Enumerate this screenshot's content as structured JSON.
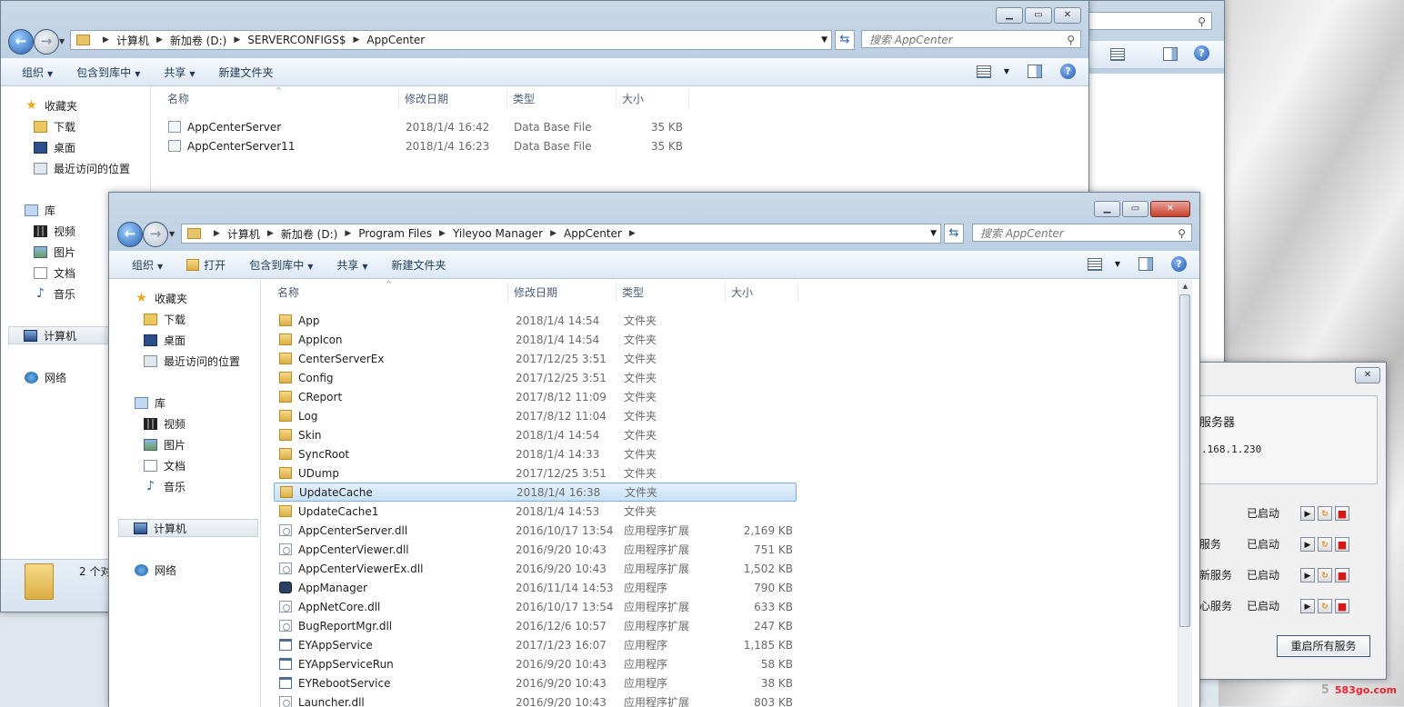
{
  "back_window": {
    "address": [
      "计算机",
      "新加卷 (D:)",
      "SERVERCONFIGS$",
      "AppCenter"
    ],
    "search_placeholder": "搜索 AppCenter",
    "commands": [
      "组织",
      "包含到库中",
      "共享",
      "新建文件夹"
    ],
    "columns": [
      "名称",
      "修改日期",
      "类型",
      "大小"
    ],
    "files": [
      {
        "name": "AppCenterServer",
        "date": "2018/1/4 16:42",
        "type": "Data Base File",
        "size": "35 KB",
        "icon": "db"
      },
      {
        "name": "AppCenterServer11",
        "date": "2018/1/4 16:23",
        "type": "Data Base File",
        "size": "35 KB",
        "icon": "db"
      }
    ],
    "nav": {
      "favorites": "收藏夹",
      "downloads": "下载",
      "desktop": "桌面",
      "recent": "最近访问的位置",
      "libraries": "库",
      "videos": "视频",
      "pictures": "图片",
      "documents": "文档",
      "music": "音乐",
      "computer": "计算机",
      "network": "网络"
    },
    "status_text": "2 个对"
  },
  "front_window": {
    "address": [
      "计算机",
      "新加卷 (D:)",
      "Program Files",
      "Yileyoo Manager",
      "AppCenter"
    ],
    "search_placeholder": "搜索 AppCenter",
    "commands": [
      "组织",
      "打开",
      "包含到库中",
      "共享",
      "新建文件夹"
    ],
    "columns": [
      "名称",
      "修改日期",
      "类型",
      "大小"
    ],
    "nav": {
      "favorites": "收藏夹",
      "downloads": "下载",
      "desktop": "桌面",
      "recent": "最近访问的位置",
      "libraries": "库",
      "videos": "视频",
      "pictures": "图片",
      "documents": "文档",
      "music": "音乐",
      "computer": "计算机",
      "network": "网络"
    },
    "files": [
      {
        "name": "App",
        "date": "2018/1/4 14:54",
        "type": "文件夹",
        "size": "",
        "icon": "folder"
      },
      {
        "name": "AppIcon",
        "date": "2018/1/4 14:54",
        "type": "文件夹",
        "size": "",
        "icon": "folder"
      },
      {
        "name": "CenterServerEx",
        "date": "2017/12/25 3:51",
        "type": "文件夹",
        "size": "",
        "icon": "folder"
      },
      {
        "name": "Config",
        "date": "2017/12/25 3:51",
        "type": "文件夹",
        "size": "",
        "icon": "folder"
      },
      {
        "name": "CReport",
        "date": "2017/8/12 11:09",
        "type": "文件夹",
        "size": "",
        "icon": "folder"
      },
      {
        "name": "Log",
        "date": "2017/8/12 11:04",
        "type": "文件夹",
        "size": "",
        "icon": "folder"
      },
      {
        "name": "Skin",
        "date": "2018/1/4 14:54",
        "type": "文件夹",
        "size": "",
        "icon": "folder"
      },
      {
        "name": "SyncRoot",
        "date": "2018/1/4 14:33",
        "type": "文件夹",
        "size": "",
        "icon": "folder"
      },
      {
        "name": "UDump",
        "date": "2017/12/25 3:51",
        "type": "文件夹",
        "size": "",
        "icon": "folder"
      },
      {
        "name": "UpdateCache",
        "date": "2018/1/4 16:38",
        "type": "文件夹",
        "size": "",
        "icon": "folder",
        "selected": true
      },
      {
        "name": "UpdateCache1",
        "date": "2018/1/4 14:53",
        "type": "文件夹",
        "size": "",
        "icon": "folder"
      },
      {
        "name": "AppCenterServer.dll",
        "date": "2016/10/17 13:54",
        "type": "应用程序扩展",
        "size": "2,169 KB",
        "icon": "dll"
      },
      {
        "name": "AppCenterViewer.dll",
        "date": "2016/9/20 10:43",
        "type": "应用程序扩展",
        "size": "751 KB",
        "icon": "dll"
      },
      {
        "name": "AppCenterViewerEx.dll",
        "date": "2016/9/20 10:43",
        "type": "应用程序扩展",
        "size": "1,502 KB",
        "icon": "dll"
      },
      {
        "name": "AppManager",
        "date": "2016/11/14 14:53",
        "type": "应用程序",
        "size": "790 KB",
        "icon": "app"
      },
      {
        "name": "AppNetCore.dll",
        "date": "2016/10/17 13:54",
        "type": "应用程序扩展",
        "size": "633 KB",
        "icon": "dll"
      },
      {
        "name": "BugReportMgr.dll",
        "date": "2016/12/6 10:57",
        "type": "应用程序扩展",
        "size": "247 KB",
        "icon": "dll"
      },
      {
        "name": "EYAppService",
        "date": "2017/1/23 16:07",
        "type": "应用程序",
        "size": "1,185 KB",
        "icon": "exe"
      },
      {
        "name": "EYAppServiceRun",
        "date": "2016/9/20 10:43",
        "type": "应用程序",
        "size": "58 KB",
        "icon": "exe"
      },
      {
        "name": "EYRebootService",
        "date": "2016/9/20 10:43",
        "type": "应用程序",
        "size": "38 KB",
        "icon": "exe"
      },
      {
        "name": "Launcher.dll",
        "date": "2016/9/20 10:43",
        "type": "应用程序扩展",
        "size": "803 KB",
        "icon": "dll"
      }
    ]
  },
  "service_dialog": {
    "group_title": "服务器",
    "ip": ".168.1.230",
    "services": [
      {
        "name": "",
        "status": "已启动"
      },
      {
        "name": "服务",
        "status": "已启动"
      },
      {
        "name": "新服务",
        "status": "已启动"
      },
      {
        "name": "心服务",
        "status": "已启动"
      }
    ],
    "restart_all": "重启所有服务"
  },
  "watermark": "583go.com"
}
